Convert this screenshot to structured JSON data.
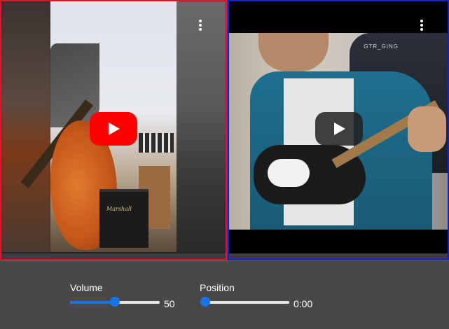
{
  "players": [
    {
      "name": "left",
      "border_color": "#e8102a",
      "play_button_color": "#ff0000"
    },
    {
      "name": "right",
      "border_color": "#1a1adf",
      "play_button_color": "#212121"
    }
  ],
  "amp_brand": "Marshall",
  "chair_brand": "GTR_GING",
  "controls": {
    "volume": {
      "label": "Volume",
      "value": 50,
      "value_text": "50"
    },
    "position": {
      "label": "Position",
      "value": 0,
      "value_text": "0:00"
    }
  },
  "icons": {
    "more": "more-vert-icon",
    "play": "play-icon"
  },
  "accent_color": "#1a73e8"
}
